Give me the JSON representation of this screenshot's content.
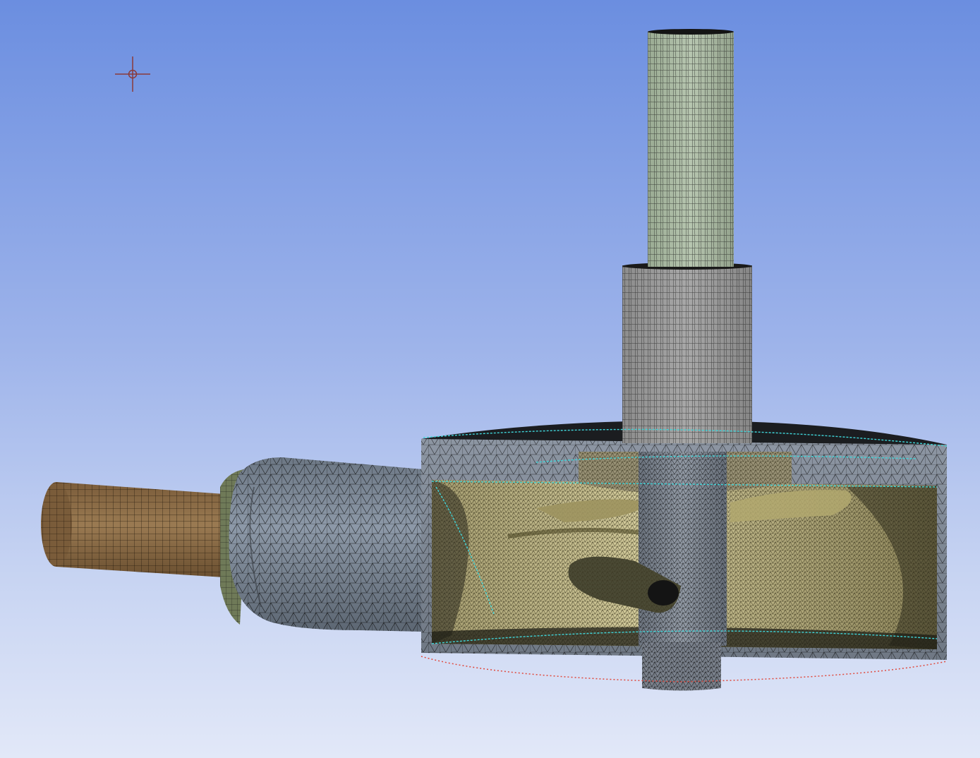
{
  "viewport": {
    "view": "mesh",
    "background_gradient": [
      "#6b8ee0",
      "#e2e8f8"
    ]
  },
  "model": {
    "parts": [
      {
        "name": "outlet-shaft",
        "color": "#a7b7a0"
      },
      {
        "name": "shaft-collar",
        "color": "#9c9c9c"
      },
      {
        "name": "inlet-pipe",
        "color": "#8a6a46"
      },
      {
        "name": "inlet-flange",
        "color": "#6b7755"
      },
      {
        "name": "inlet-elbow",
        "color": "#7a8593"
      },
      {
        "name": "volute-casing",
        "color": "#8b94a0"
      },
      {
        "name": "impeller-passage",
        "color": "#c9c091"
      },
      {
        "name": "hub",
        "color": "#7d8591"
      },
      {
        "name": "bottom-outlet",
        "color": "#7b828d"
      }
    ],
    "edge_colors": {
      "mesh_lines": "#111111",
      "cyan_edges": "#3fd4d8",
      "red_dotted": "#e04a3e"
    }
  },
  "cursor": {
    "icon": "crosshair-icon",
    "color": "#8a3a3a"
  }
}
